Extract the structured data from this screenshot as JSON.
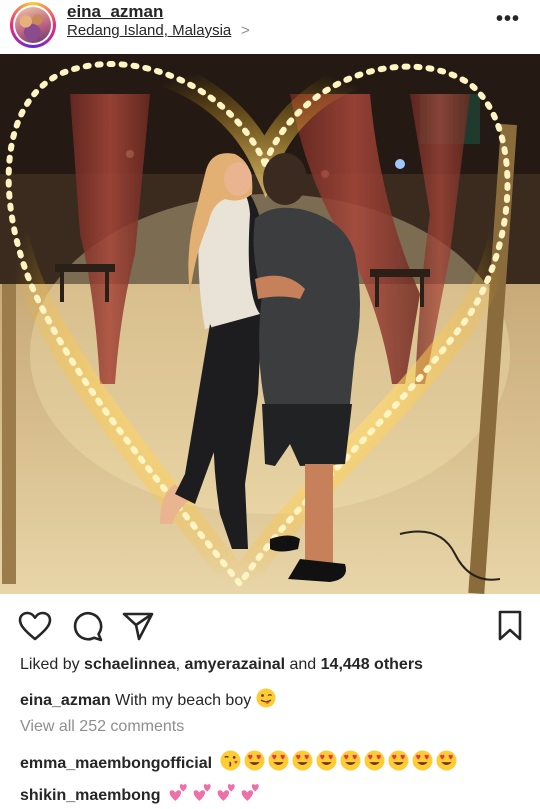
{
  "post": {
    "username": "eina_azman",
    "location": "Redang Island, Malaysia",
    "location_chevron": ">",
    "more_icon": "more-horizontal-icon"
  },
  "actions": {
    "like_icon": "heart-icon",
    "comment_icon": "comment-icon",
    "share_icon": "send-icon",
    "save_icon": "bookmark-icon"
  },
  "likes": {
    "prefix": "Liked by ",
    "user1": "schaelinnea",
    "sep": ", ",
    "user2": "amyerazainal",
    "and": " and ",
    "others": "14,448 others"
  },
  "caption": {
    "username": "eina_azman",
    "text": "With my beach boy",
    "emoji": "winking-face-with-tongue"
  },
  "view_all_comments": "View all 252 comments",
  "comments": [
    {
      "username": "emma_maembongofficial",
      "emojis": [
        "face-blowing-kiss",
        "heart-eyes",
        "heart-eyes",
        "heart-eyes",
        "heart-eyes",
        "heart-eyes",
        "heart-eyes",
        "heart-eyes",
        "heart-eyes",
        "heart-eyes"
      ]
    },
    {
      "username": "shikin_maembong",
      "emojis": [
        "two-hearts",
        "two-hearts",
        "two-hearts",
        "two-hearts"
      ]
    }
  ],
  "colors": {
    "text": "#262626",
    "secondary": "#8e8e8e",
    "background": "#ffffff",
    "heart_pink": "#f06292",
    "emoji_yellow": "#ffcc33"
  }
}
